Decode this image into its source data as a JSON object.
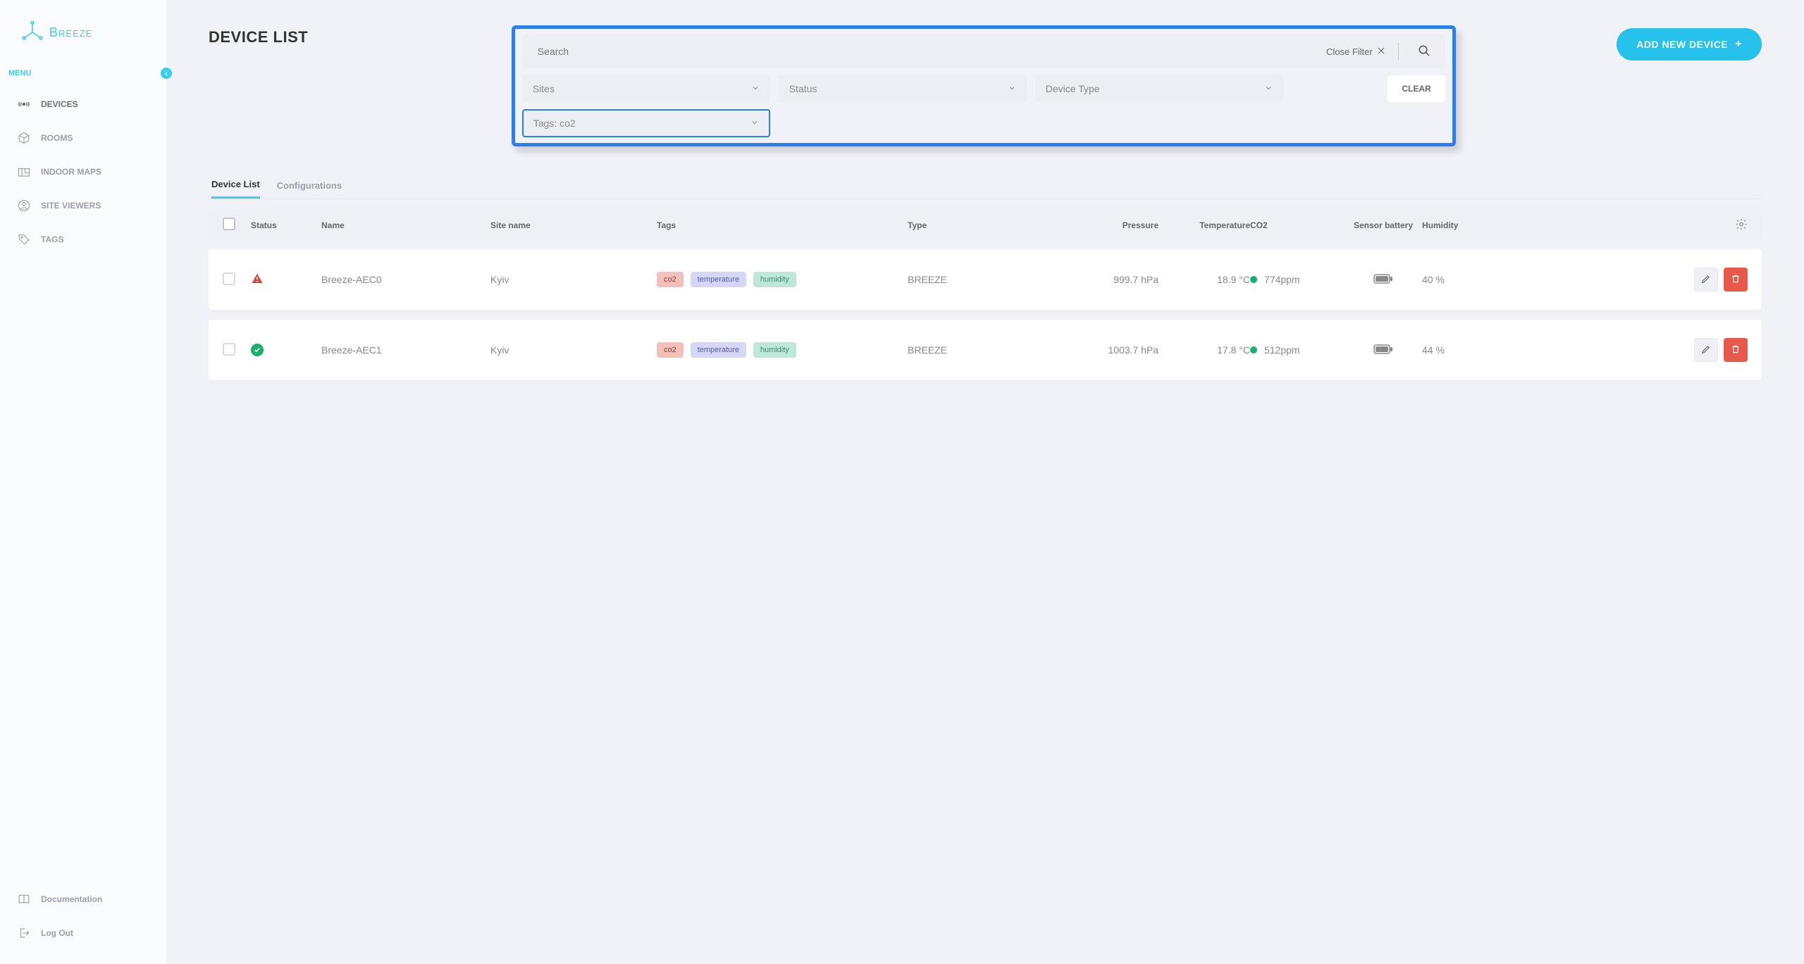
{
  "brand": {
    "name": "Breeze",
    "color": "#3acdef"
  },
  "sidebar": {
    "menu_label": "MENU",
    "items": [
      {
        "label": "DEVICES",
        "icon": "broadcast-icon",
        "active": true
      },
      {
        "label": "ROOMS",
        "icon": "cube-icon",
        "active": false
      },
      {
        "label": "INDOOR MAPS",
        "icon": "floorplan-icon",
        "active": false
      },
      {
        "label": "SITE VIEWERS",
        "icon": "user-circle-icon",
        "active": false
      },
      {
        "label": "TAGS",
        "icon": "tag-icon",
        "active": false
      }
    ],
    "bottom": [
      {
        "label": "Documentation",
        "icon": "book-icon"
      },
      {
        "label": "Log Out",
        "icon": "logout-icon"
      }
    ]
  },
  "header": {
    "title": "DEVICE LIST",
    "add_button": "ADD NEW DEVICE"
  },
  "filter": {
    "search_placeholder": "Search",
    "close_label": "Close Filter",
    "clear_label": "CLEAR",
    "dropdowns": {
      "sites": "Sites",
      "status": "Status",
      "device_type": "Device Type",
      "tags": "Tags: co2"
    }
  },
  "tabs": [
    {
      "label": "Device List",
      "active": true
    },
    {
      "label": "Configurations",
      "active": false
    }
  ],
  "table": {
    "columns": {
      "status": "Status",
      "name": "Name",
      "site": "Site name",
      "tags": "Tags",
      "type": "Type",
      "pressure": "Pressure",
      "temperature": "Temperature",
      "co2": "CO2",
      "battery": "Sensor battery",
      "humidity": "Humidity"
    },
    "rows": [
      {
        "status": "alert",
        "name": "Breeze-AEC0",
        "site": "Kyiv",
        "tags": [
          "co2",
          "temperature",
          "humidity"
        ],
        "type": "BREEZE",
        "pressure": "999.7 hPa",
        "temperature": "18.9 °C",
        "co2": "774ppm",
        "co2_status": "ok",
        "humidity": "40 %"
      },
      {
        "status": "ok",
        "name": "Breeze-AEC1",
        "site": "Kyiv",
        "tags": [
          "co2",
          "temperature",
          "humidity"
        ],
        "type": "BREEZE",
        "pressure": "1003.7 hPa",
        "temperature": "17.8 °C",
        "co2": "512ppm",
        "co2_status": "ok",
        "humidity": "44 %"
      }
    ]
  }
}
